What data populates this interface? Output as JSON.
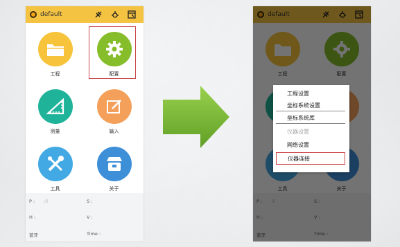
{
  "app": {
    "title": "default"
  },
  "tiles": [
    {
      "key": "project",
      "label": "工程",
      "color": "#f7c33a",
      "icon": "folder-icon"
    },
    {
      "key": "config",
      "label": "配置",
      "color": "#86bd2b",
      "icon": "gear-icon"
    },
    {
      "key": "survey",
      "label": "测量",
      "color": "#1fb39a",
      "icon": "ruler-icon"
    },
    {
      "key": "input",
      "label": "输入",
      "color": "#f4a05a",
      "icon": "edit-icon"
    },
    {
      "key": "tools",
      "label": "工具",
      "color": "#43a9e4",
      "icon": "tools-icon"
    },
    {
      "key": "about",
      "label": "关于",
      "color": "#3d8fd8",
      "icon": "store-icon"
    }
  ],
  "status": {
    "p_label": "P :",
    "s_label": "S :",
    "h_label": "H :",
    "v_label": "V :",
    "bt_label": "蓝牙",
    "time_label": "Time :"
  },
  "menu": {
    "items": [
      {
        "label": "工程设置",
        "state": "normal"
      },
      {
        "label": "坐标系统设置",
        "state": "normal"
      },
      {
        "label": "坐标系统库",
        "state": "normal"
      },
      {
        "label": "仪器设置",
        "state": "disabled"
      },
      {
        "label": "网络设置",
        "state": "normal"
      },
      {
        "label": "仪器连接",
        "state": "highlighted"
      }
    ]
  },
  "colors": {
    "topbar": "#f5c342",
    "highlight_border": "#c9474a",
    "arrow": "#7cbf35"
  }
}
